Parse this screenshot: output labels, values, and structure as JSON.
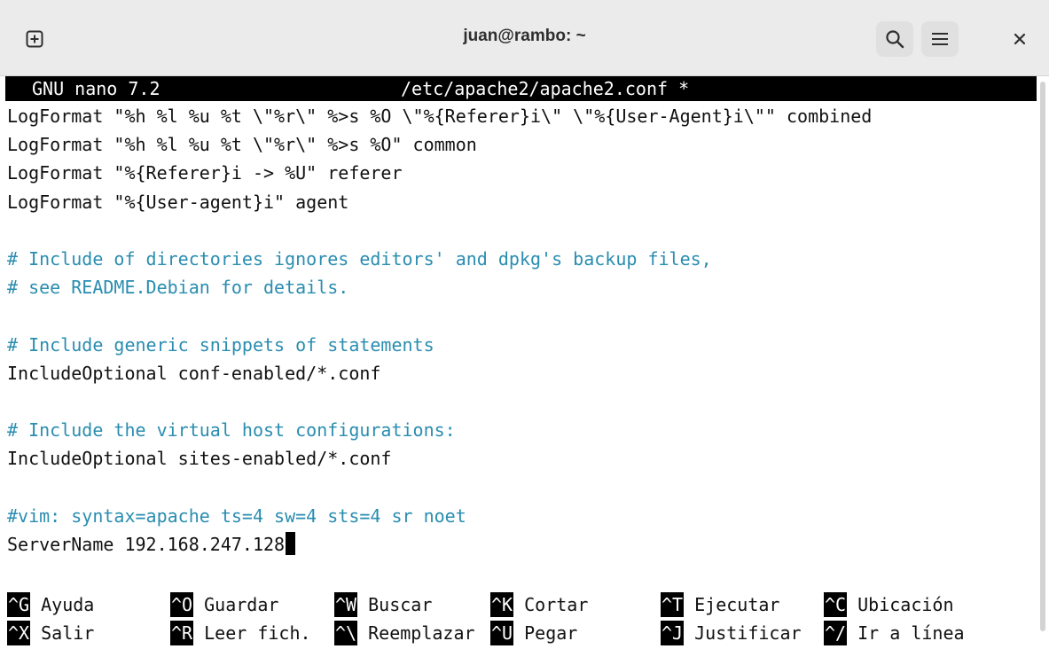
{
  "window": {
    "title": "juan@rambo: ~",
    "icons": [
      "new-tab-icon",
      "search-icon",
      "hamburger-menu-icon",
      "close-icon"
    ]
  },
  "nano": {
    "version_label": "GNU nano 7.2",
    "file_label": "/etc/apache2/apache2.conf *"
  },
  "lines": [
    {
      "text": "LogFormat \"%h %l %u %t \\\"%r\\\" %>s %O \\\"%{Referer}i\\\" \\\"%{User-Agent}i\\\"\" combined",
      "kind": "code"
    },
    {
      "text": "LogFormat \"%h %l %u %t \\\"%r\\\" %>s %O\" common",
      "kind": "code"
    },
    {
      "text": "LogFormat \"%{Referer}i -> %U\" referer",
      "kind": "code"
    },
    {
      "text": "LogFormat \"%{User-agent}i\" agent",
      "kind": "code"
    },
    {
      "text": "",
      "kind": "blank"
    },
    {
      "text": "# Include of directories ignores editors' and dpkg's backup files,",
      "kind": "comment"
    },
    {
      "text": "# see README.Debian for details.",
      "kind": "comment"
    },
    {
      "text": "",
      "kind": "blank"
    },
    {
      "text": "# Include generic snippets of statements",
      "kind": "comment"
    },
    {
      "text": "IncludeOptional conf-enabled/*.conf",
      "kind": "code"
    },
    {
      "text": "",
      "kind": "blank"
    },
    {
      "text": "# Include the virtual host configurations:",
      "kind": "comment"
    },
    {
      "text": "IncludeOptional sites-enabled/*.conf",
      "kind": "code"
    },
    {
      "text": "",
      "kind": "blank"
    },
    {
      "text": "#vim: syntax=apache ts=4 sw=4 sts=4 sr noet",
      "kind": "comment"
    },
    {
      "text": "ServerName 192.168.247.128",
      "kind": "code"
    }
  ],
  "shortcuts": {
    "row1": [
      {
        "key": "^G",
        "label": "Ayuda"
      },
      {
        "key": "^O",
        "label": "Guardar"
      },
      {
        "key": "^W",
        "label": "Buscar"
      },
      {
        "key": "^K",
        "label": "Cortar"
      },
      {
        "key": "^T",
        "label": "Ejecutar"
      },
      {
        "key": "^C",
        "label": "Ubicación"
      }
    ],
    "row2": [
      {
        "key": "^X",
        "label": "Salir"
      },
      {
        "key": "^R",
        "label": "Leer fich."
      },
      {
        "key": "^\\",
        "label": "Reemplazar"
      },
      {
        "key": "^U",
        "label": "Pegar"
      },
      {
        "key": "^J",
        "label": "Justificar"
      },
      {
        "key": "^/",
        "label": "Ir a línea"
      }
    ]
  },
  "colors": {
    "comment": "#2a8db0",
    "terminal_bg": "#ffffff",
    "status_bar_bg": "#000000"
  }
}
